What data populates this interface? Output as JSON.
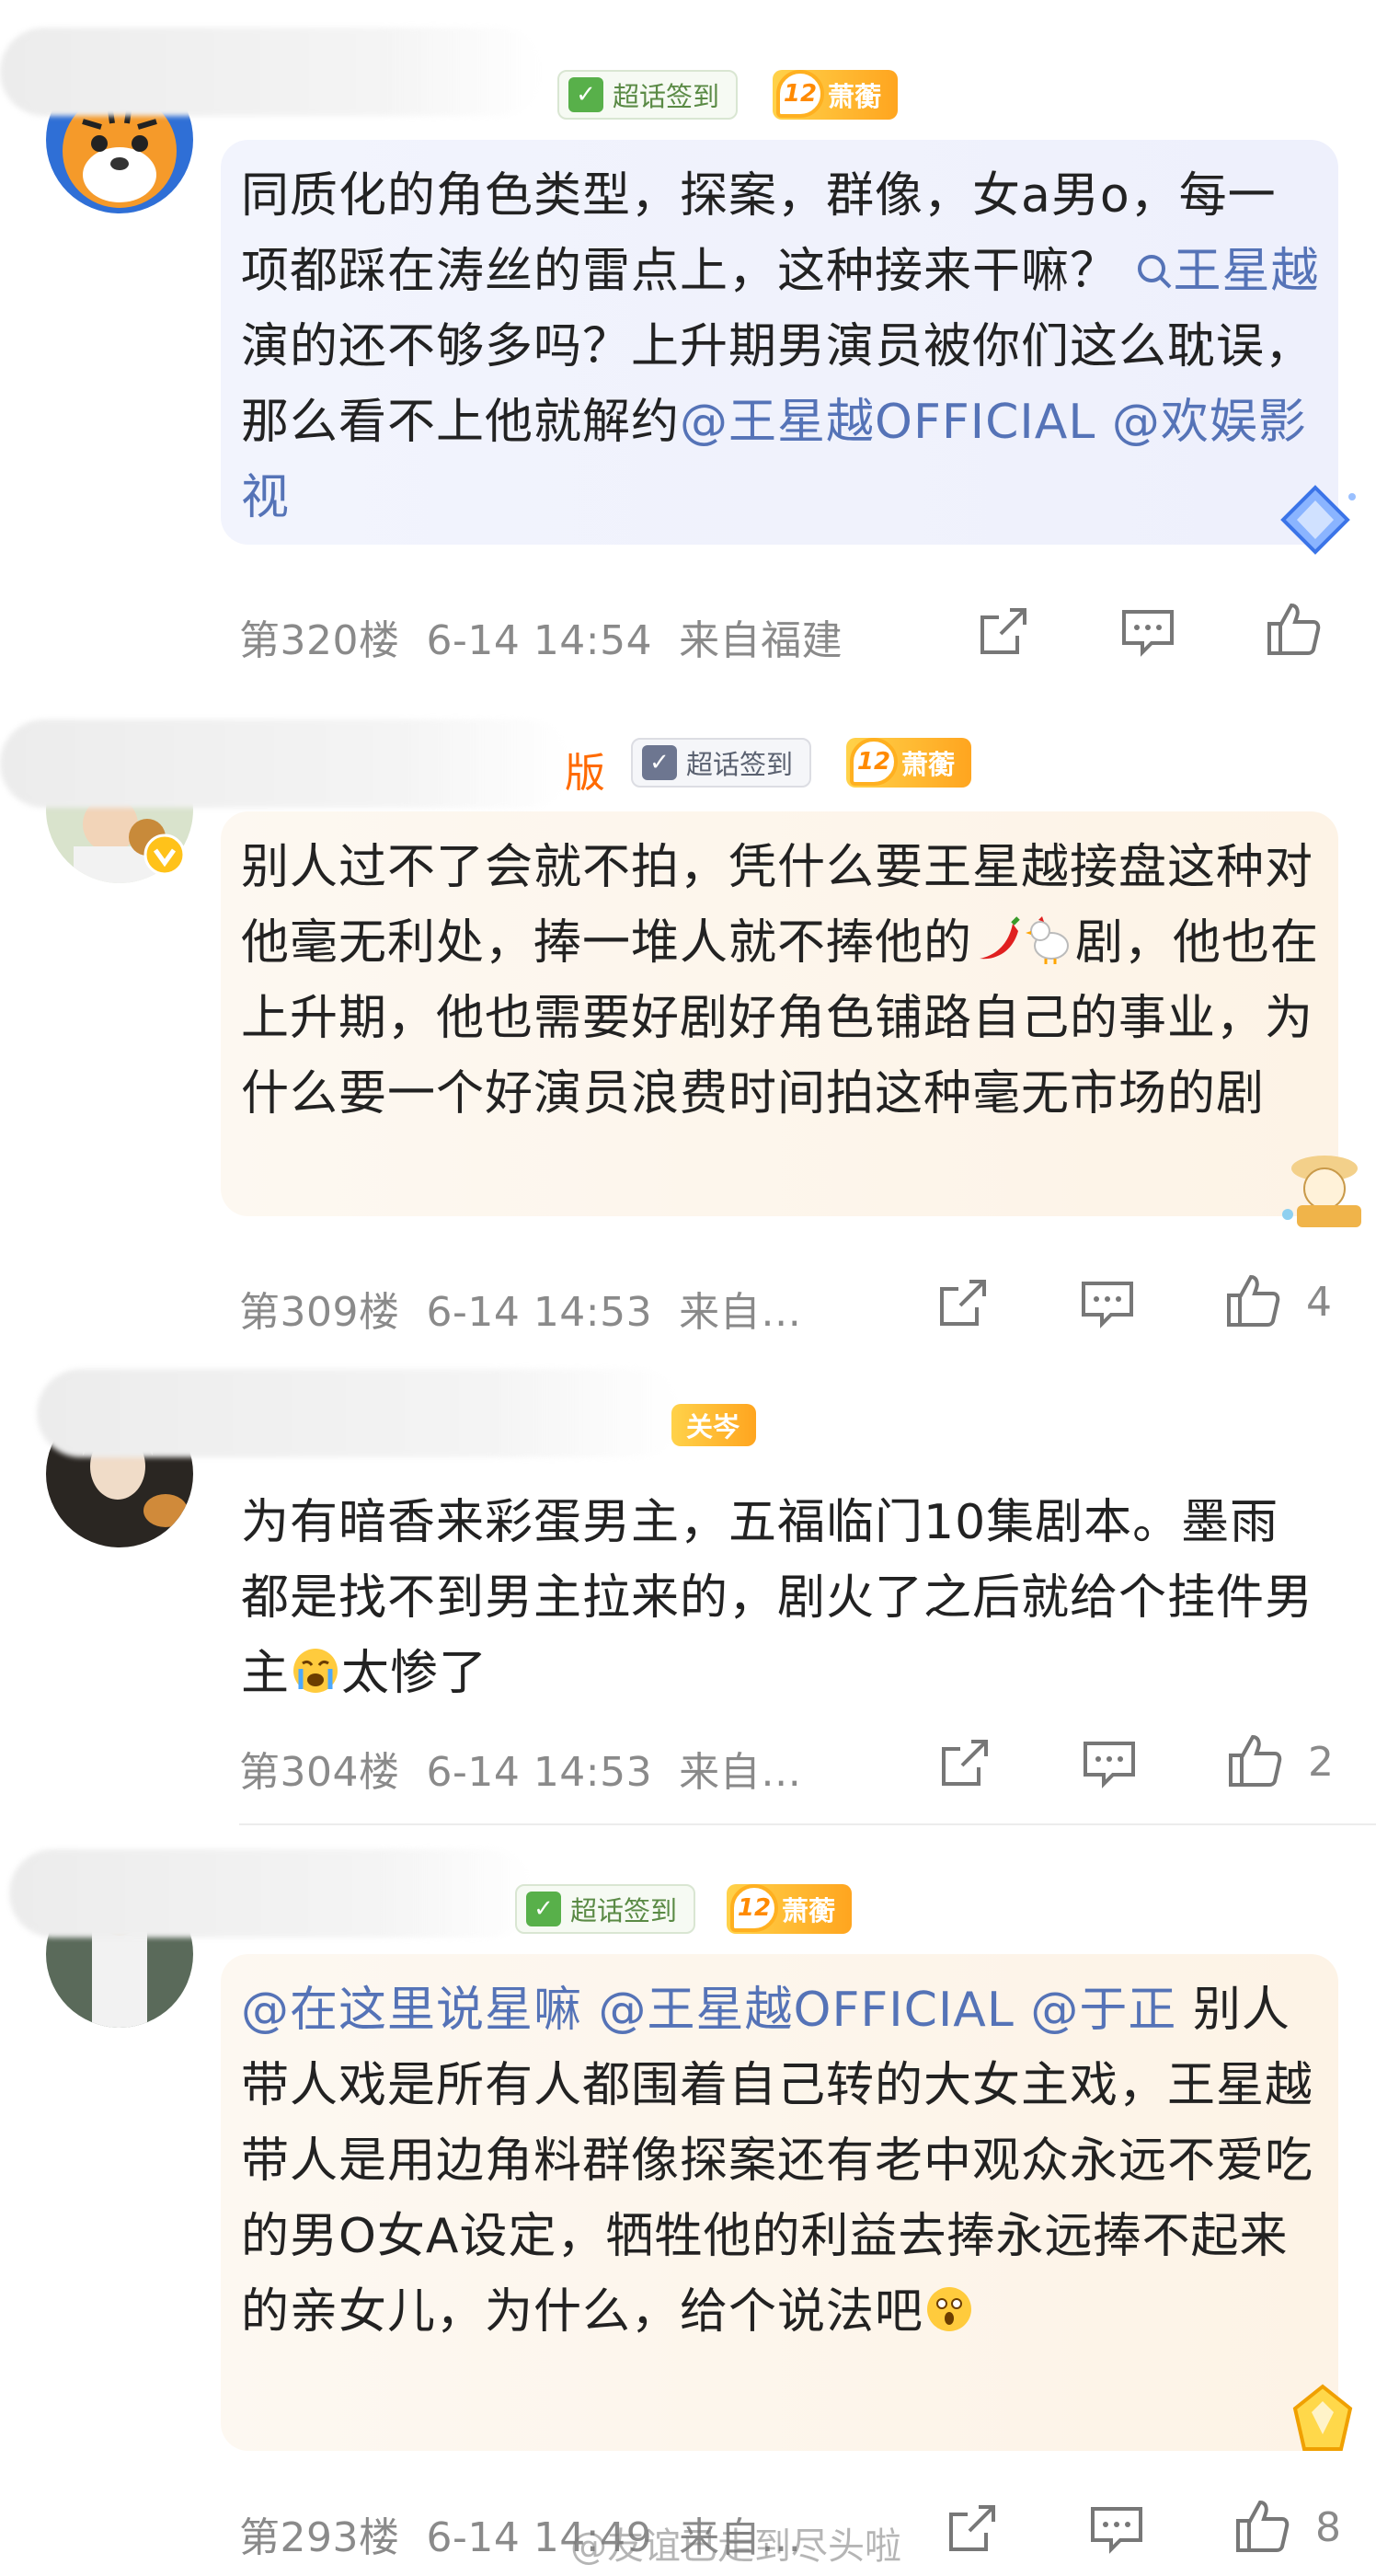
{
  "comments": [
    {
      "name_tail": "",
      "badge_chaohua": "超话签到",
      "badge_level_num": "12",
      "badge_level_name": "萧蘅",
      "text_a": "同质化的角色类型，探案，群像，女a男o，每一项都踩在涛丝的雷点上，这种接来干嘛？",
      "search_mention": "王星越",
      "text_b": " 演的还不够多吗？上升期男演员被你们这么耽误，那么看不上他就解约",
      "mention1": "@王星越OFFICIAL",
      "mention2": " @欢娱影视",
      "floor": "第320楼",
      "time": "6-14 14:54",
      "location": "来自福建",
      "likes": ""
    },
    {
      "name_tail": "版",
      "badge_chaohua": "超话签到",
      "badge_level_num": "12",
      "badge_level_name": "萧蘅",
      "text_a": "别人过不了会就不拍，凭什么要王星越接盘这种对他毫无利处，捧一堆人就不捧他的",
      "text_b": "剧，他也在上升期，他也需要好剧好角色铺路自己的事业，为什么要一个好演员浪费时间拍这种毫无市场的剧",
      "floor": "第309楼",
      "time": "6-14 14:53",
      "location": "来自…",
      "likes": "4"
    },
    {
      "badge_level_name": "关岑",
      "text_a": "为有暗香来彩蛋男主，五福临门10集剧本。墨雨都是找不到男主拉来的，剧火了之后就给个挂件男主",
      "text_b": "太惨了",
      "floor": "第304楼",
      "time": "6-14 14:53",
      "location": "来自…",
      "likes": "2"
    },
    {
      "badge_chaohua": "超话签到",
      "badge_level_num": "12",
      "badge_level_name": "萧蘅",
      "mention1": "@在这里说星嘛",
      "mention2": " @王星越OFFICIAL",
      "mention3": " @于正",
      "text_a": " 别人带人戏是所有人都围着自己转的大女主戏，王星越带人是用边角料群像探案还有老中观众永远不爱吃的男O女A设定，牺牲他的利益去捧永远捧不起来的亲女儿，为什么，给个说法吧",
      "floor": "第293楼",
      "time": "6-14 14:49",
      "location": "来自…",
      "likes": "8"
    }
  ],
  "watermark": "@友谊已走到尽头啦"
}
